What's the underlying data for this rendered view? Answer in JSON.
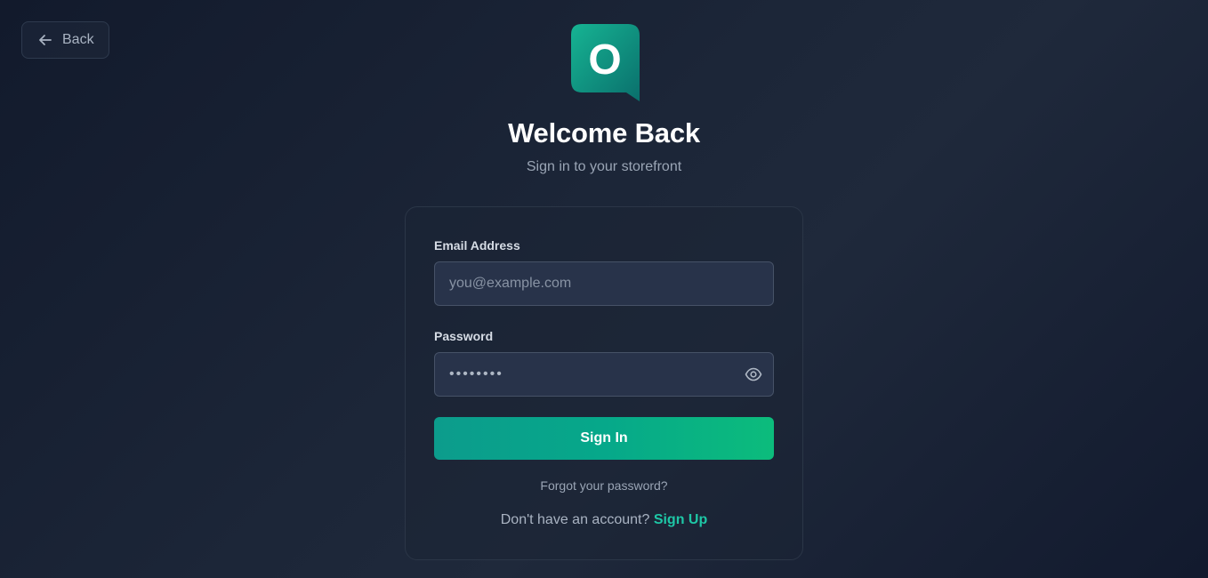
{
  "nav": {
    "back_label": "Back"
  },
  "brand": {
    "logo_letter": "O",
    "accent_color": "#0e9d84"
  },
  "header": {
    "title": "Welcome Back",
    "subtitle": "Sign in to your storefront"
  },
  "form": {
    "email_label": "Email Address",
    "email_placeholder": "you@example.com",
    "email_value": "",
    "password_label": "Password",
    "password_value": "••••••••",
    "submit_label": "Sign In",
    "forgot_label": "Forgot your password?",
    "signup_prompt": "Don't have an account?",
    "signup_label": "Sign Up"
  }
}
